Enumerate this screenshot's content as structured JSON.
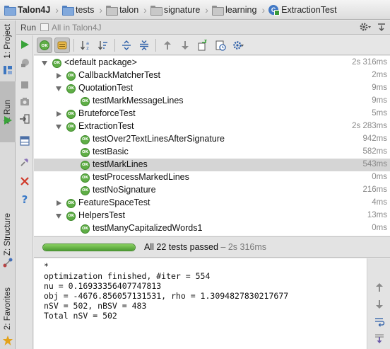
{
  "breadcrumb": [
    {
      "label": "Talon4J",
      "icon": "project-folder-icon",
      "bold": true
    },
    {
      "label": "tests",
      "icon": "folder-icon"
    },
    {
      "label": "talon",
      "icon": "package-folder-icon"
    },
    {
      "label": "signature",
      "icon": "package-folder-icon"
    },
    {
      "label": "learning",
      "icon": "package-folder-icon"
    },
    {
      "label": "ExtractionTest",
      "icon": "test-class-icon"
    }
  ],
  "side_tabs": {
    "project": "1: Project",
    "run": "4: Run",
    "structure": "Z: Structure",
    "favorites": "2: Favorites"
  },
  "run_header": {
    "label": "Run",
    "config_name": "All in Talon4J",
    "right_icons": [
      "settings-gear-icon",
      "hide-window-icon"
    ]
  },
  "run_toolbar": [
    "run-icon",
    "debug-icon",
    "stop-icon",
    "dump-threads-icon",
    "exit-icon",
    "layout-icon",
    "pin-icon",
    "close-icon",
    "help-icon"
  ],
  "test_toolbar": [
    "show-passed-icon",
    "show-ignored-icon",
    "sort-alpha-icon",
    "sort-duration-icon",
    "expand-all-icon",
    "collapse-all-icon",
    "previous-test-icon",
    "next-test-icon",
    "export-icon",
    "history-icon",
    "test-settings-icon"
  ],
  "tree": [
    {
      "name": "<default package>",
      "time": "2s 316ms",
      "level": 0,
      "arrow": "down"
    },
    {
      "name": "CallbackMatcherTest",
      "time": "2ms",
      "level": 1,
      "arrow": "right"
    },
    {
      "name": "QuotationTest",
      "time": "9ms",
      "level": 1,
      "arrow": "down"
    },
    {
      "name": "testMarkMessageLines",
      "time": "9ms",
      "level": 2
    },
    {
      "name": "BruteforceTest",
      "time": "5ms",
      "level": 1,
      "arrow": "right"
    },
    {
      "name": "ExtractionTest",
      "time": "2s 283ms",
      "level": 1,
      "arrow": "down"
    },
    {
      "name": "testOver2TextLinesAfterSignature",
      "time": "942ms",
      "level": 2
    },
    {
      "name": "testBasic",
      "time": "582ms",
      "level": 2
    },
    {
      "name": "testMarkLines",
      "time": "543ms",
      "level": 2,
      "selected": true
    },
    {
      "name": "testProcessMarkedLines",
      "time": "0ms",
      "level": 2
    },
    {
      "name": "testNoSignature",
      "time": "216ms",
      "level": 2
    },
    {
      "name": "FeatureSpaceTest",
      "time": "4ms",
      "level": 1,
      "arrow": "right"
    },
    {
      "name": "HelpersTest",
      "time": "13ms",
      "level": 1,
      "arrow": "down"
    },
    {
      "name": "testManyCapitalizedWords1",
      "time": "0ms",
      "level": 2
    }
  ],
  "ok_badge": "OK",
  "status": {
    "summary": "All 22 tests passed",
    "separator": " – ",
    "time": "2s 316ms",
    "progress": 1.0
  },
  "console": [
    "*",
    "optimization finished, #iter = 554",
    "nu = 0.16933356407747813",
    "obj = -4676.856057131531, rho = 1.3094827830217677",
    "nSV = 502, nBSV = 483",
    "Total nSV = 502"
  ],
  "console_toolbar": [
    "scroll-up-icon",
    "scroll-down-icon",
    "soft-wrap-icon",
    "scroll-to-end-icon"
  ],
  "colors": {
    "pass_green": "#5fae46",
    "selection": "#d5d5d5"
  }
}
